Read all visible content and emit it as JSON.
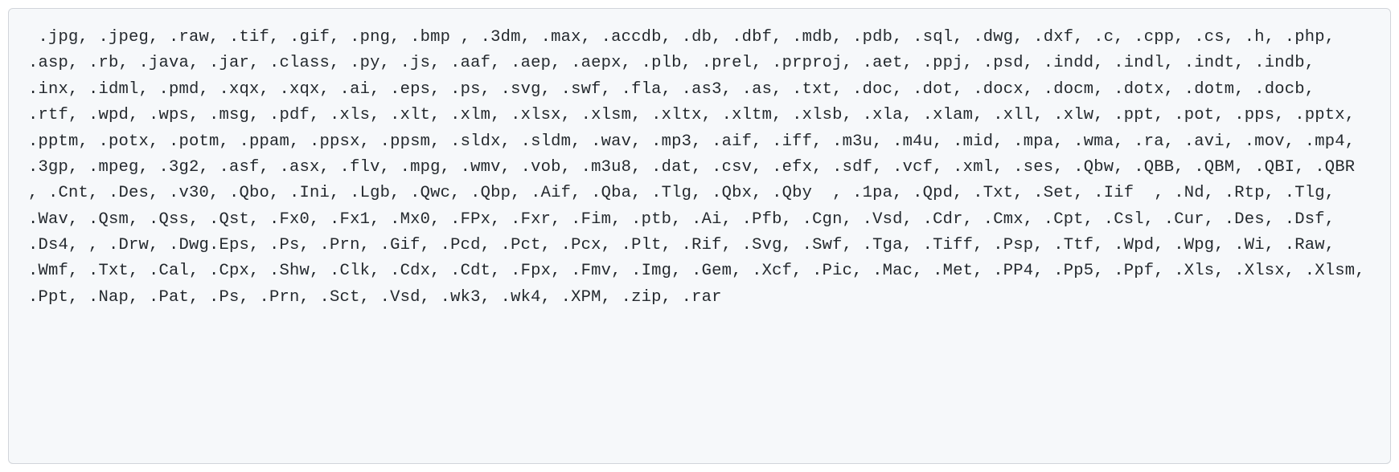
{
  "code_block": {
    "content": " .jpg, .jpeg, .raw, .tif, .gif, .png, .bmp , .3dm, .max, .accdb, .db, .dbf, .mdb, .pdb, .sql, .dwg, .dxf, .c, .cpp, .cs, .h, .php, .asp, .rb, .java, .jar, .class, .py, .js, .aaf, .aep, .aepx, .plb, .prel, .prproj, .aet, .ppj, .psd, .indd, .indl, .indt, .indb, .inx, .idml, .pmd, .xqx, .xqx, .ai, .eps, .ps, .svg, .swf, .fla, .as3, .as, .txt, .doc, .dot, .docx, .docm, .dotx, .dotm, .docb, .rtf, .wpd, .wps, .msg, .pdf, .xls, .xlt, .xlm, .xlsx, .xlsm, .xltx, .xltm, .xlsb, .xla, .xlam, .xll, .xlw, .ppt, .pot, .pps, .pptx, .pptm, .potx, .potm, .ppam, .ppsx, .ppsm, .sldx, .sldm, .wav, .mp3, .aif, .iff, .m3u, .m4u, .mid, .mpa, .wma, .ra, .avi, .mov, .mp4, .3gp, .mpeg, .3g2, .asf, .asx, .flv, .mpg, .wmv, .vob, .m3u8, .dat, .csv, .efx, .sdf, .vcf, .xml, .ses, .Qbw, .QBB, .QBM, .QBI, .QBR  , .Cnt, .Des, .v30, .Qbo, .Ini, .Lgb, .Qwc, .Qbp, .Aif, .Qba, .Tlg, .Qbx, .Qby  , .1pa, .Qpd, .Txt, .Set, .Iif  , .Nd, .Rtp, .Tlg, .Wav, .Qsm, .Qss, .Qst, .Fx0, .Fx1, .Mx0, .FPx, .Fxr, .Fim, .ptb, .Ai, .Pfb, .Cgn, .Vsd, .Cdr, .Cmx, .Cpt, .Csl, .Cur, .Des, .Dsf, .Ds4, , .Drw, .Dwg.Eps, .Ps, .Prn, .Gif, .Pcd, .Pct, .Pcx, .Plt, .Rif, .Svg, .Swf, .Tga, .Tiff, .Psp, .Ttf, .Wpd, .Wpg, .Wi, .Raw, .Wmf, .Txt, .Cal, .Cpx, .Shw, .Clk, .Cdx, .Cdt, .Fpx, .Fmv, .Img, .Gem, .Xcf, .Pic, .Mac, .Met, .PP4, .Pp5, .Ppf, .Xls, .Xlsx, .Xlsm, .Ppt, .Nap, .Pat, .Ps, .Prn, .Sct, .Vsd, .wk3, .wk4, .XPM, .zip, .rar"
  }
}
